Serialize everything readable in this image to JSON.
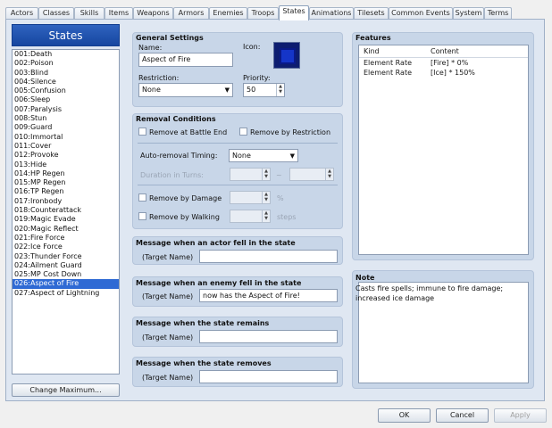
{
  "tabs": [
    {
      "label": "Actors",
      "active": false
    },
    {
      "label": "Classes",
      "active": false
    },
    {
      "label": "Skills",
      "active": false
    },
    {
      "label": "Items",
      "active": false
    },
    {
      "label": "Weapons",
      "active": false
    },
    {
      "label": "Armors",
      "active": false
    },
    {
      "label": "Enemies",
      "active": false
    },
    {
      "label": "Troops",
      "active": false
    },
    {
      "label": "States",
      "active": true
    },
    {
      "label": "Animations",
      "active": false
    },
    {
      "label": "Tilesets",
      "active": false
    },
    {
      "label": "Common Events",
      "active": false
    },
    {
      "label": "System",
      "active": false
    },
    {
      "label": "Terms",
      "active": false
    }
  ],
  "states_panel": {
    "title": "States",
    "items": [
      "001:Death",
      "002:Poison",
      "003:Blind",
      "004:Silence",
      "005:Confusion",
      "006:Sleep",
      "007:Paralysis",
      "008:Stun",
      "009:Guard",
      "010:Immortal",
      "011:Cover",
      "012:Provoke",
      "013:Hide",
      "014:HP Regen",
      "015:MP Regen",
      "016:TP Regen",
      "017:Ironbody",
      "018:Counterattack",
      "019:Magic Evade",
      "020:Magic Reflect",
      "021:Fire Force",
      "022:Ice Force",
      "023:Thunder Force",
      "024:Ailment Guard",
      "025:MP Cost Down",
      "026:Aspect of Fire",
      "027:Aspect of Lightning"
    ],
    "selected_index": 25,
    "change_max_label": "Change Maximum..."
  },
  "general": {
    "title": "General Settings",
    "name_label": "Name:",
    "name_value": "Aspect of Fire",
    "icon_label": "Icon:",
    "restriction_label": "Restriction:",
    "restriction_value": "None",
    "priority_label": "Priority:",
    "priority_value": "50"
  },
  "removal": {
    "title": "Removal Conditions",
    "remove_battle_end": "Remove at Battle End",
    "remove_restriction": "Remove by Restriction",
    "auto_timing_label": "Auto-removal Timing:",
    "auto_timing_value": "None",
    "duration_label": "Duration in Turns:",
    "duration_sep": "~",
    "remove_damage": "Remove by Damage",
    "damage_unit": "%",
    "remove_walking": "Remove by Walking",
    "walking_unit": "steps"
  },
  "messages": [
    {
      "title": "Message when an actor fell in the state",
      "target": "(Target Name)",
      "value": ""
    },
    {
      "title": "Message when an enemy fell in the state",
      "target": "(Target Name)",
      "value": "now has the Aspect of Fire!"
    },
    {
      "title": "Message when the state remains",
      "target": "(Target Name)",
      "value": ""
    },
    {
      "title": "Message when the state removes",
      "target": "(Target Name)",
      "value": ""
    }
  ],
  "features": {
    "title": "Features",
    "col_kind": "Kind",
    "col_content": "Content",
    "rows": [
      {
        "kind": "Element Rate",
        "content": "[Fire] * 0%"
      },
      {
        "kind": "Element Rate",
        "content": "[Ice] * 150%"
      }
    ]
  },
  "note": {
    "title": "Note",
    "text": "Casts fire spells; immune to fire damage; increased ice damage"
  },
  "footer": {
    "ok": "OK",
    "cancel": "Cancel",
    "apply": "Apply"
  }
}
